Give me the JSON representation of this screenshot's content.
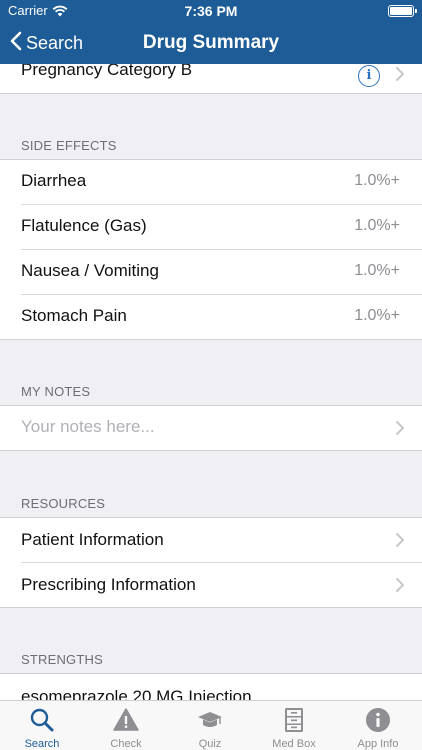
{
  "status_bar": {
    "carrier": "Carrier",
    "time": "7:36 PM"
  },
  "nav": {
    "back_label": "Search",
    "title": "Drug Summary"
  },
  "pregnancy": {
    "label": "Pregnancy Category B"
  },
  "side_effects": {
    "header": "SIDE EFFECTS",
    "items": [
      {
        "label": "Diarrhea",
        "value": "1.0%+"
      },
      {
        "label": "Flatulence (Gas)",
        "value": "1.0%+"
      },
      {
        "label": "Nausea / Vomiting",
        "value": "1.0%+"
      },
      {
        "label": "Stomach Pain",
        "value": "1.0%+"
      }
    ]
  },
  "my_notes": {
    "header": "MY NOTES",
    "placeholder": "Your notes here..."
  },
  "resources": {
    "header": "RESOURCES",
    "items": [
      {
        "label": "Patient Information"
      },
      {
        "label": "Prescribing Information"
      }
    ]
  },
  "strengths": {
    "header": "STRENGTHS",
    "items": [
      {
        "label": "esomeprazole 20 MG Injection"
      }
    ]
  },
  "tabbar": {
    "items": [
      {
        "label": "Search",
        "icon": "search-icon",
        "active": true
      },
      {
        "label": "Check",
        "icon": "warning-icon"
      },
      {
        "label": "Quiz",
        "icon": "graduation-cap-icon"
      },
      {
        "label": "Med Box",
        "icon": "cabinet-icon"
      },
      {
        "label": "App Info",
        "icon": "info-icon"
      }
    ]
  },
  "colors": {
    "nav_bar": "#1d5c96",
    "accent": "#2a72c4",
    "background": "#efeff4",
    "secondary_text": "#8e8e93"
  }
}
